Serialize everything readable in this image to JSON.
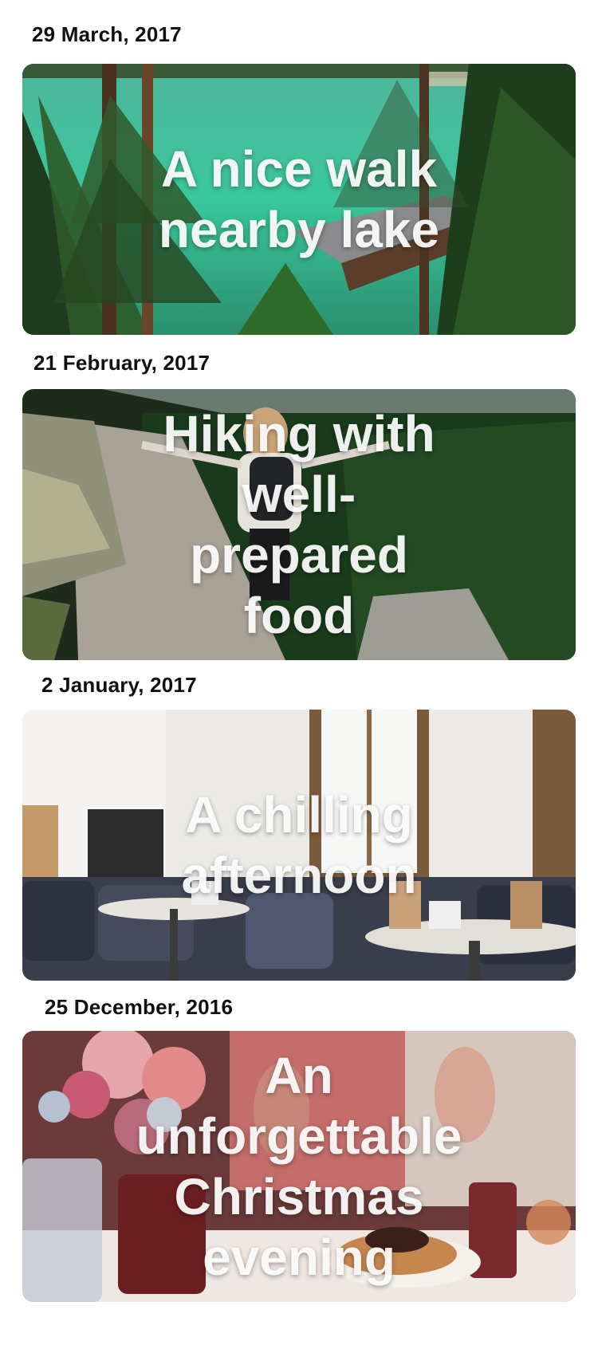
{
  "entries": [
    {
      "date": "29 March, 2017",
      "title": "A nice walk nearby lake"
    },
    {
      "date": "21 February, 2017",
      "title": "Hiking with well-prepared food"
    },
    {
      "date": "2 January, 2017",
      "title": "A chilling afternoon"
    },
    {
      "date": "25 December, 2016",
      "title": "An unforgettable Christmas evening"
    }
  ]
}
